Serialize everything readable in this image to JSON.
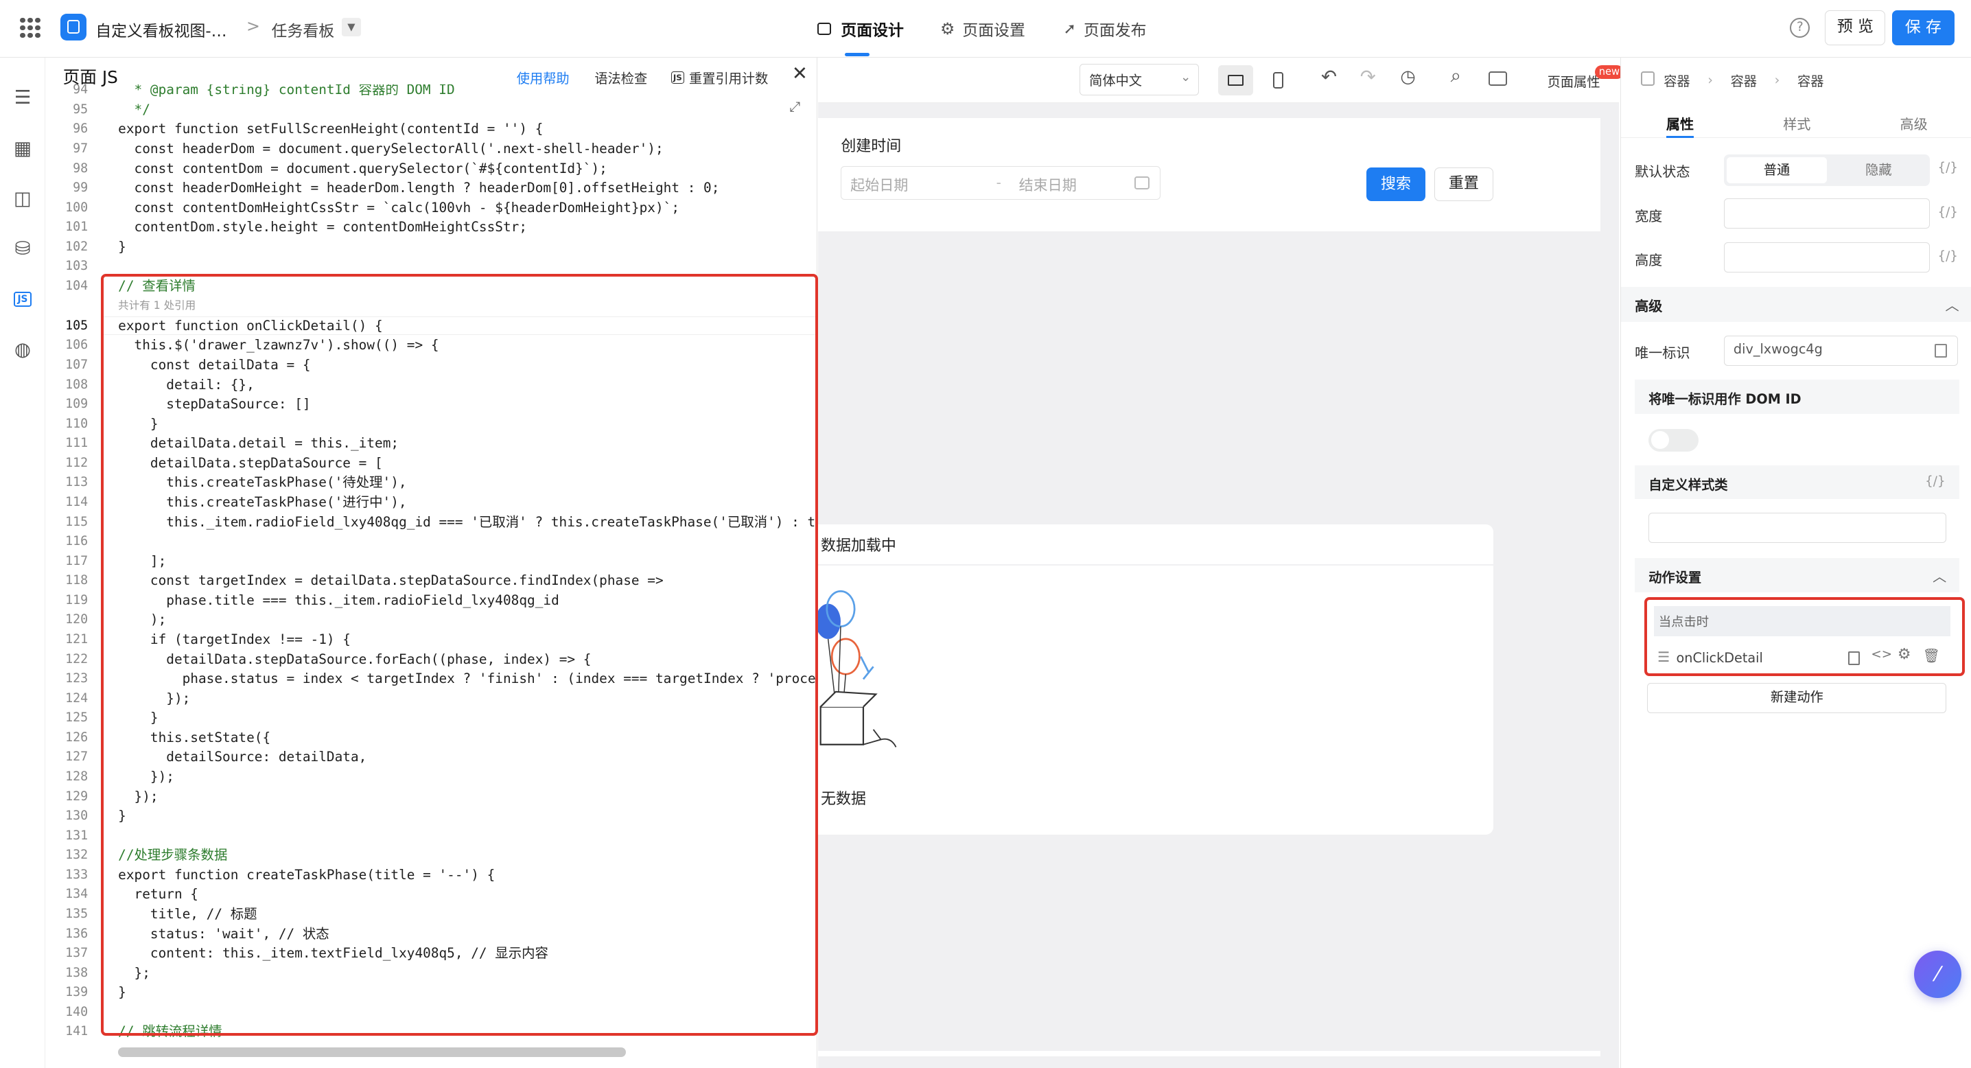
{
  "topbar": {
    "app_title": "自定义看板视图-…",
    "breadcrumb_sep": ">",
    "page_name": "任务看板",
    "tabs": [
      {
        "label": "页面设计",
        "active": true
      },
      {
        "label": "页面设置",
        "active": false
      },
      {
        "label": "页面发布",
        "active": false
      }
    ],
    "preview_label": "预 览",
    "save_label": "保 存"
  },
  "editor": {
    "title": "页面 JS",
    "help_label": "使用帮助",
    "lint_label": "语法检查",
    "reset_ref_label": "重置引用计数",
    "ref_hint": "共计有 1 处引用",
    "lines": [
      {
        "n": "94",
        "text": "  * @param {string} contentId 容器的 DOM ID",
        "cls": "cm"
      },
      {
        "n": "95",
        "text": "  */",
        "cls": "cm"
      },
      {
        "n": "96",
        "text": "export function setFullScreenHeight(contentId = '') {",
        "cls": ""
      },
      {
        "n": "97",
        "text": "  const headerDom = document.querySelectorAll('.next-shell-header');",
        "cls": ""
      },
      {
        "n": "98",
        "text": "  const contentDom = document.querySelector(`#${contentId}`);",
        "cls": ""
      },
      {
        "n": "99",
        "text": "  const headerDomHeight = headerDom.length ? headerDom[0].offsetHeight : 0;",
        "cls": ""
      },
      {
        "n": "100",
        "text": "  const contentDomHeightCssStr = `calc(100vh - ${headerDomHeight}px)`;",
        "cls": ""
      },
      {
        "n": "101",
        "text": "  contentDom.style.height = contentDomHeightCssStr;",
        "cls": ""
      },
      {
        "n": "102",
        "text": "}",
        "cls": ""
      },
      {
        "n": "103",
        "text": "",
        "cls": ""
      },
      {
        "n": "104",
        "text": "// 查看详情",
        "cls": "cm"
      },
      {
        "n": "105",
        "text": "export function onClickDetail() {",
        "cls": ""
      },
      {
        "n": "106",
        "text": "  this.$('drawer_lzawnz7v').show(() => {",
        "cls": ""
      },
      {
        "n": "107",
        "text": "    const detailData = {",
        "cls": ""
      },
      {
        "n": "108",
        "text": "      detail: {},",
        "cls": ""
      },
      {
        "n": "109",
        "text": "      stepDataSource: []",
        "cls": ""
      },
      {
        "n": "110",
        "text": "    }",
        "cls": ""
      },
      {
        "n": "111",
        "text": "    detailData.detail = this._item;",
        "cls": ""
      },
      {
        "n": "112",
        "text": "    detailData.stepDataSource = [",
        "cls": ""
      },
      {
        "n": "113",
        "text": "      this.createTaskPhase('待处理'),",
        "cls": ""
      },
      {
        "n": "114",
        "text": "      this.createTaskPhase('进行中'),",
        "cls": ""
      },
      {
        "n": "115",
        "text": "      this._item.radioField_lxy408qg_id === '已取消' ? this.createTaskPhase('已取消') : th",
        "cls": ""
      },
      {
        "n": "116",
        "text": "",
        "cls": ""
      },
      {
        "n": "117",
        "text": "    ];",
        "cls": ""
      },
      {
        "n": "118",
        "text": "    const targetIndex = detailData.stepDataSource.findIndex(phase =>",
        "cls": ""
      },
      {
        "n": "119",
        "text": "      phase.title === this._item.radioField_lxy408qg_id",
        "cls": ""
      },
      {
        "n": "120",
        "text": "    );",
        "cls": ""
      },
      {
        "n": "121",
        "text": "    if (targetIndex !== -1) {",
        "cls": ""
      },
      {
        "n": "122",
        "text": "      detailData.stepDataSource.forEach((phase, index) => {",
        "cls": ""
      },
      {
        "n": "123",
        "text": "        phase.status = index < targetIndex ? 'finish' : (index === targetIndex ? 'proces",
        "cls": ""
      },
      {
        "n": "124",
        "text": "      });",
        "cls": ""
      },
      {
        "n": "125",
        "text": "    }",
        "cls": ""
      },
      {
        "n": "126",
        "text": "    this.setState({",
        "cls": ""
      },
      {
        "n": "127",
        "text": "      detailSource: detailData,",
        "cls": ""
      },
      {
        "n": "128",
        "text": "    });",
        "cls": ""
      },
      {
        "n": "129",
        "text": "  });",
        "cls": ""
      },
      {
        "n": "130",
        "text": "}",
        "cls": ""
      },
      {
        "n": "131",
        "text": "",
        "cls": ""
      },
      {
        "n": "132",
        "text": "//处理步骤条数据",
        "cls": "cm"
      },
      {
        "n": "133",
        "text": "export function createTaskPhase(title = '--') {",
        "cls": ""
      },
      {
        "n": "134",
        "text": "  return {",
        "cls": ""
      },
      {
        "n": "135",
        "text": "    title, // 标题",
        "cls": ""
      },
      {
        "n": "136",
        "text": "    status: 'wait', // 状态",
        "cls": ""
      },
      {
        "n": "137",
        "text": "    content: this._item.textField_lxy408q5, // 显示内容",
        "cls": ""
      },
      {
        "n": "138",
        "text": "  };",
        "cls": ""
      },
      {
        "n": "139",
        "text": "}",
        "cls": ""
      },
      {
        "n": "140",
        "text": "",
        "cls": ""
      },
      {
        "n": "141",
        "text": "// 跳转流程详情",
        "cls": "cm"
      }
    ]
  },
  "toolbar": {
    "language": "简体中文",
    "page_props_label": "页面属性",
    "new_badge": "new"
  },
  "canvas": {
    "filter_label": "创建时间",
    "start_placeholder": "起始日期",
    "range_sep": "-",
    "end_placeholder": "结束日期",
    "search_label": "搜索",
    "reset_label": "重置",
    "loading_text": "数据加载中",
    "empty_text": "无数据"
  },
  "rpanel": {
    "crumbs": [
      "容器",
      "容器",
      "容器"
    ],
    "tabs": [
      "属性",
      "样式",
      "高级"
    ],
    "default_state_label": "默认状态",
    "state_options": [
      "普通",
      "隐藏"
    ],
    "width_label": "宽度",
    "height_label": "高度",
    "var_btn": "{/}",
    "advanced_title": "高级",
    "uid_label": "唯一标识",
    "uid_value": "div_lxwogc4g",
    "dom_id_label": "将唯一标识用作 DOM ID",
    "custom_class_label": "自定义样式类",
    "action_title": "动作设置",
    "action_event": "当点击时",
    "action_handler": "onClickDetail",
    "new_action_label": "新建动作"
  },
  "colors": {
    "accent": "#1e7df2",
    "highlight": "#e0352b"
  }
}
